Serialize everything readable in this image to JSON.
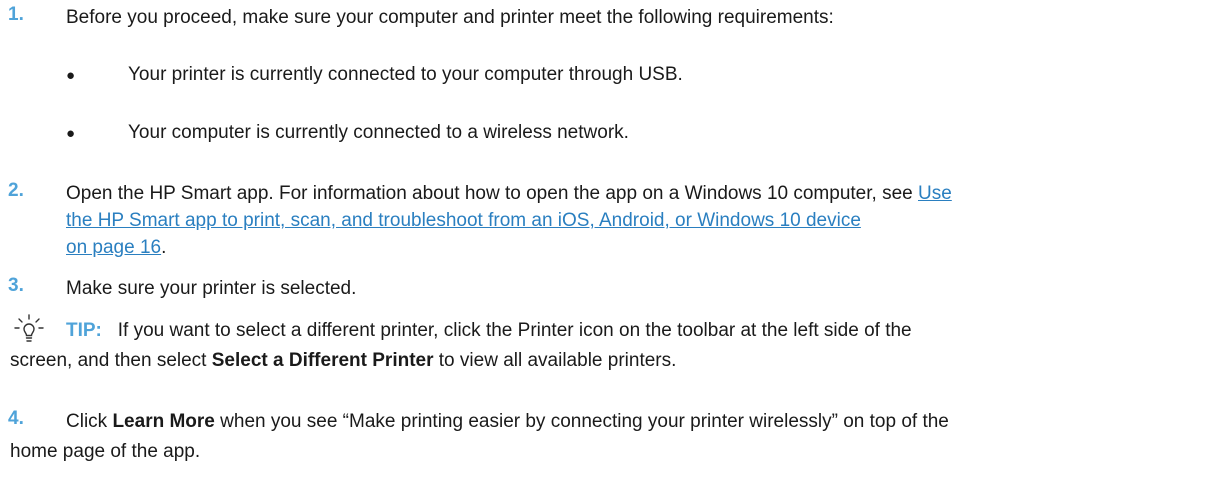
{
  "steps": [
    {
      "num": "1.",
      "text": "Before you proceed, make sure your computer and printer meet the following requirements:"
    },
    {
      "num": "2.",
      "text_before": "Open the HP Smart app. For information about how to open the app on a Windows 10 computer, see ",
      "link_line1": "Use",
      "link_line2": "the HP Smart app to print, scan, and troubleshoot from an iOS, Android, or Windows 10 device",
      "link_line3": "on page 16",
      "text_after": "."
    },
    {
      "num": "3.",
      "text": "Make sure your printer is selected."
    },
    {
      "num": "4.",
      "text_before": "Click ",
      "bold": "Learn More",
      "text_after_line1": " when you see “Make printing easier by connecting your printer wirelessly” on top of the",
      "text_line2": "home page of the app."
    }
  ],
  "requirements": [
    {
      "bullet": "●",
      "text": "Your printer is currently connected to your computer through USB."
    },
    {
      "bullet": "●",
      "text": "Your computer is currently connected to a wireless network."
    }
  ],
  "tip": {
    "icon": "lightbulb-icon",
    "label": "TIP:",
    "text_line1": "If you want to select a different printer, click the Printer icon on the toolbar at the left side of the",
    "text_line2_before": "screen, and then select ",
    "bold": "Select a Different Printer",
    "text_line2_after": " to view all available printers."
  },
  "colors": {
    "accent": "#4fa3d9",
    "link": "#2a7fc0",
    "text": "#1a1a1a"
  }
}
